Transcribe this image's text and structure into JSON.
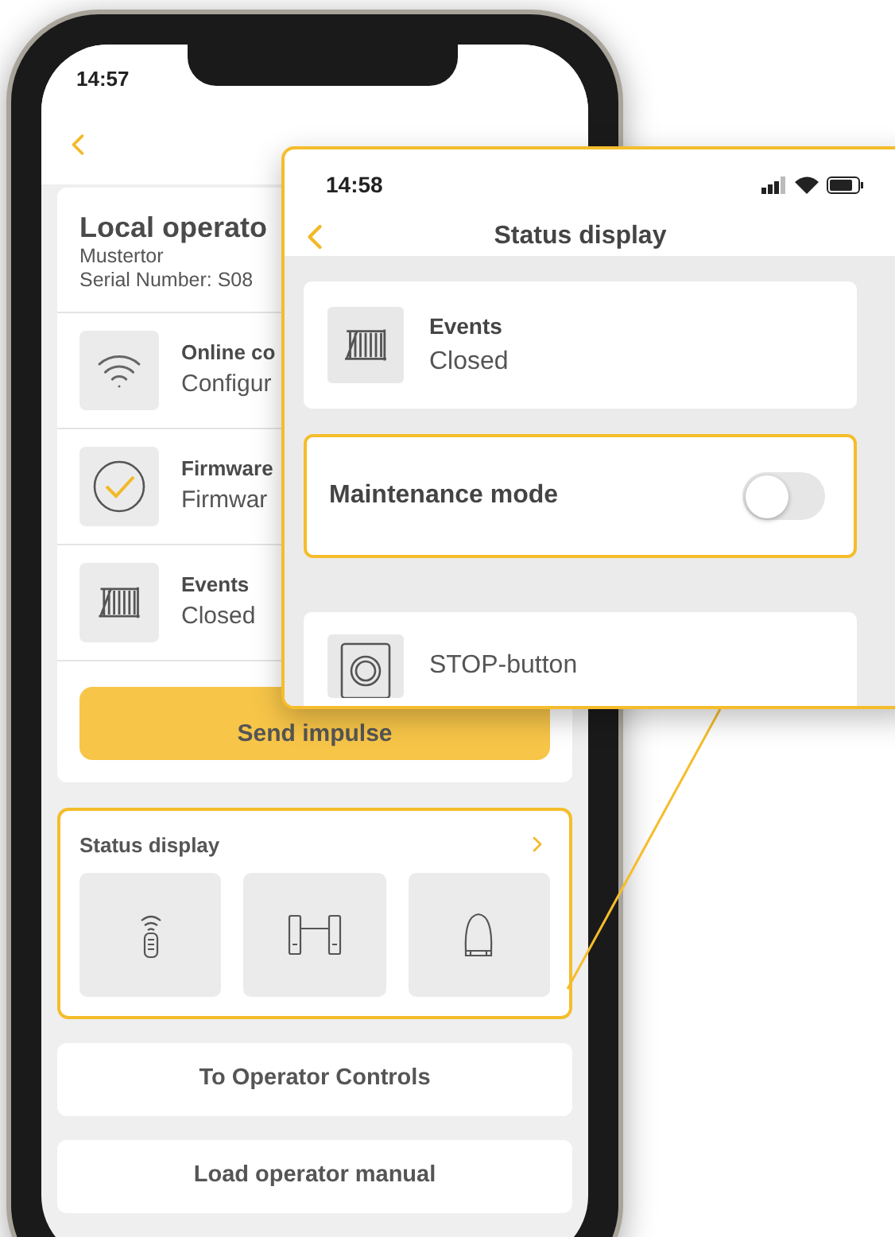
{
  "phone": {
    "time": "14:57",
    "operator": {
      "title": "Local operato",
      "name": "Mustertor",
      "serial": "Serial Number: S08"
    },
    "rows": [
      {
        "kind": "wifi",
        "title": "Online co",
        "subtitle": "Configur"
      },
      {
        "kind": "check",
        "title": "Firmware",
        "subtitle": "Firmwar"
      },
      {
        "kind": "gate",
        "title": "Events",
        "subtitle": "Closed"
      }
    ],
    "send_button": "Send impulse",
    "status_card": {
      "title": "Status display",
      "tiles": [
        {
          "kind": "remote"
        },
        {
          "kind": "photocell"
        },
        {
          "kind": "lamp"
        }
      ]
    },
    "buttons": [
      "To Operator Controls",
      "Load operator manual"
    ]
  },
  "zoom_panel": {
    "time": "14:58",
    "title": "Status display",
    "events": {
      "title": "Events",
      "subtitle": "Closed"
    },
    "maintenance": {
      "label": "Maintenance mode",
      "on": false
    },
    "stop": {
      "label": "STOP-button"
    }
  }
}
